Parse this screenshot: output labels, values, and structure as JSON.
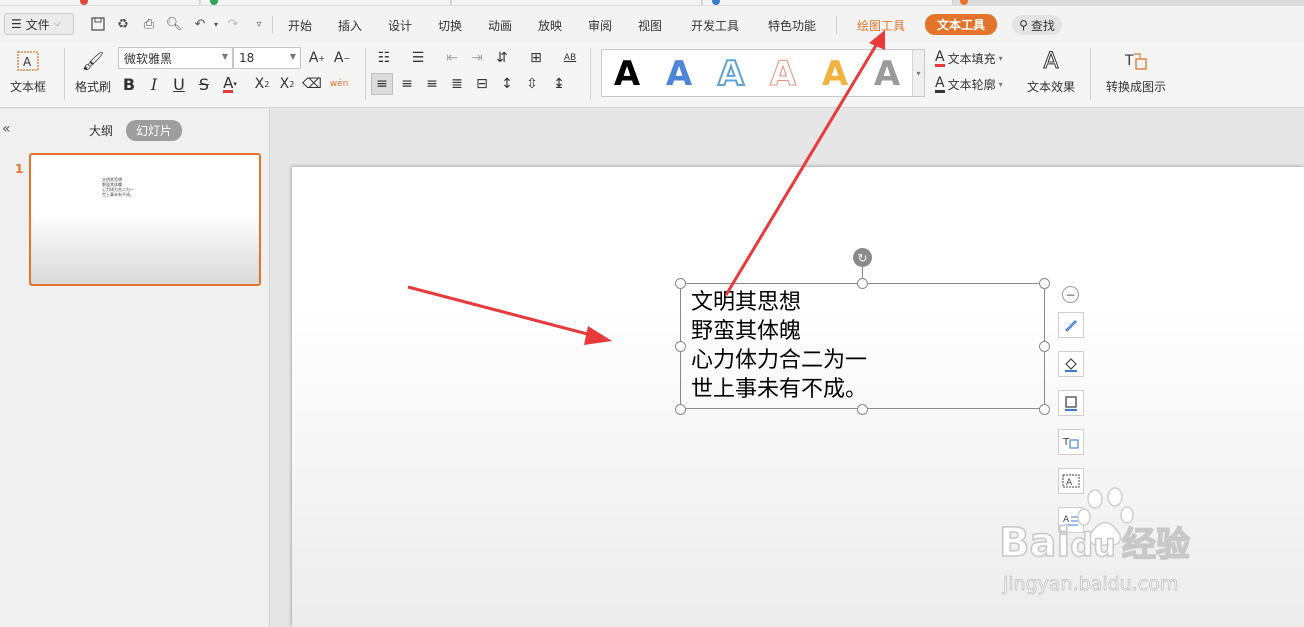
{
  "menu": {
    "file_label": "文件",
    "items": [
      "开始",
      "插入",
      "设计",
      "切换",
      "动画",
      "放映",
      "审阅",
      "视图",
      "开发工具",
      "特色功能"
    ],
    "drawing_tools": "绘图工具",
    "text_tools": "文本工具",
    "search": "查找"
  },
  "ribbon": {
    "textbox_label": "文本框",
    "format_painter_label": "格式刷",
    "font_name": "微软雅黑",
    "font_size": "18",
    "text_fill_label": "文本填充",
    "text_outline_label": "文本轮廓",
    "text_effect_label": "文本效果",
    "convert_label": "转换成图示",
    "wen_label": "wén",
    "ab_label": "AB",
    "gallery_letter": "A"
  },
  "leftpane": {
    "outline_tab": "大纲",
    "slides_tab": "幻灯片",
    "slide_number": "1",
    "thumb_text": "文明其思想\n野蛮其体魄\n心力体力合二为一\n世上事未有不成。"
  },
  "slide": {
    "lines": [
      "文明其思想",
      "野蛮其体魄",
      "心力体力合二为一",
      "世上事未有不成。"
    ]
  },
  "watermark": {
    "brand": "Bai",
    "brand_suffix": "du",
    "jingyan": "经验",
    "url": "jingyan.baidu.com"
  },
  "colors": {
    "accent": "#e4742c",
    "arrow": "#e8393b"
  }
}
